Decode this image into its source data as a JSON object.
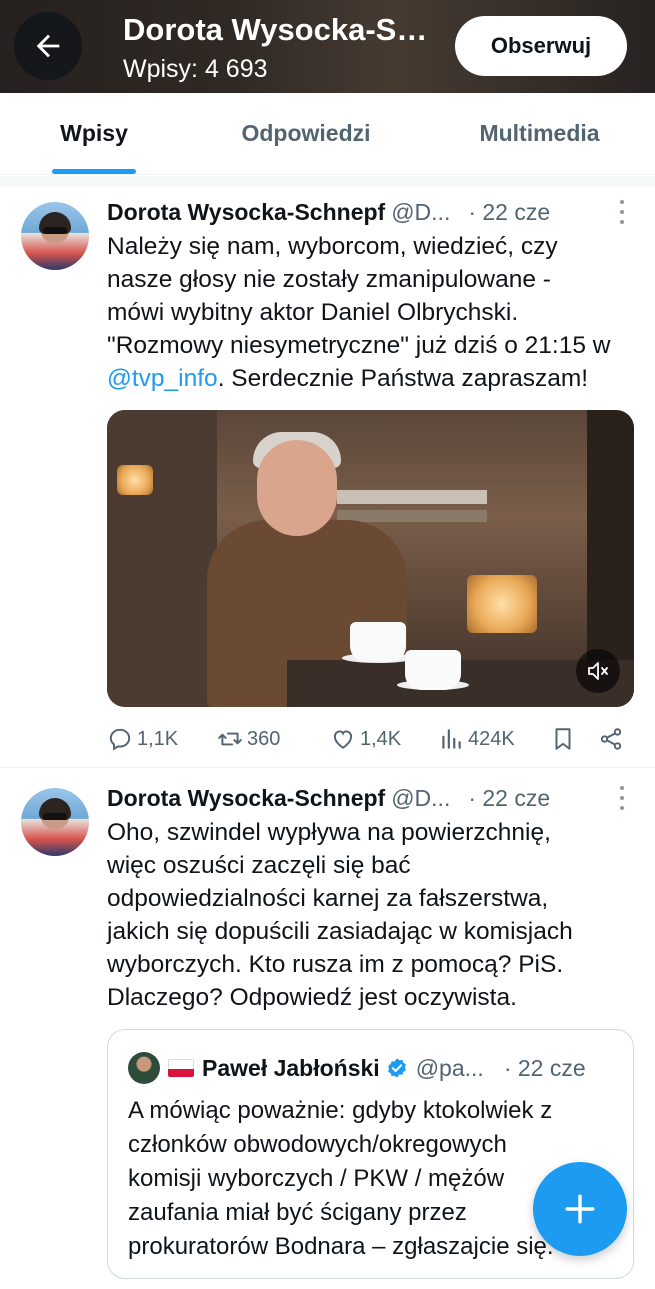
{
  "header": {
    "title": "Dorota Wysocka-Schnepf",
    "posts_label": "Wpisy: 4 693",
    "follow_label": "Obserwuj"
  },
  "tabs": [
    {
      "label": "Wpisy",
      "active": true
    },
    {
      "label": "Odpowiedzi",
      "active": false
    },
    {
      "label": "Multimedia",
      "active": false
    }
  ],
  "tweets": [
    {
      "name": "Dorota Wysocka-Schnepf",
      "handle": "@D...",
      "time": "· 22 cze",
      "text_lines": [
        "Należy się nam, wyborcom, wiedzieć, czy",
        "nasze głosy nie zostały zmanipulowane -",
        "mówi wybitny aktor Daniel Olbrychski.",
        "\"Rozmowy niesymetryczne\" już dziś o 21:15 w"
      ],
      "mention": "@tvp_info",
      "text_tail": ". Serdecznie Państwa zapraszam!",
      "stats": {
        "replies": "1,1K",
        "retweets": "360",
        "likes": "1,4K",
        "views": "424K"
      }
    },
    {
      "name": "Dorota Wysocka-Schnepf",
      "handle": "@D...",
      "time": "· 22 cze",
      "text_lines": [
        "Oho, szwindel wypływa na powierzchnię,",
        "więc oszuści zaczęli się bać",
        "odpowiedzialności karnej za fałszerstwa,",
        "jakich się dopuścili zasiadając w komisjach",
        "wyborczych. Kto rusza im z pomocą? PiS.",
        "Dlaczego? Odpowiedź jest oczywista."
      ],
      "quote": {
        "name": "Paweł Jabłoński",
        "handle": "@pa...",
        "time": "· 22 cze",
        "text_lines": [
          "A mówiąc poważnie: gdyby ktokolwiek z",
          "członków obwodowych/okregowych",
          "komisji wyborczych / PKW / mężów",
          "zaufania miał być ścigany przez",
          "prokuratorów Bodnara – zgłaszajcie się."
        ]
      }
    }
  ],
  "colors": {
    "accent": "#1d9bf0",
    "text": "#0f1419",
    "muted": "#536471"
  }
}
